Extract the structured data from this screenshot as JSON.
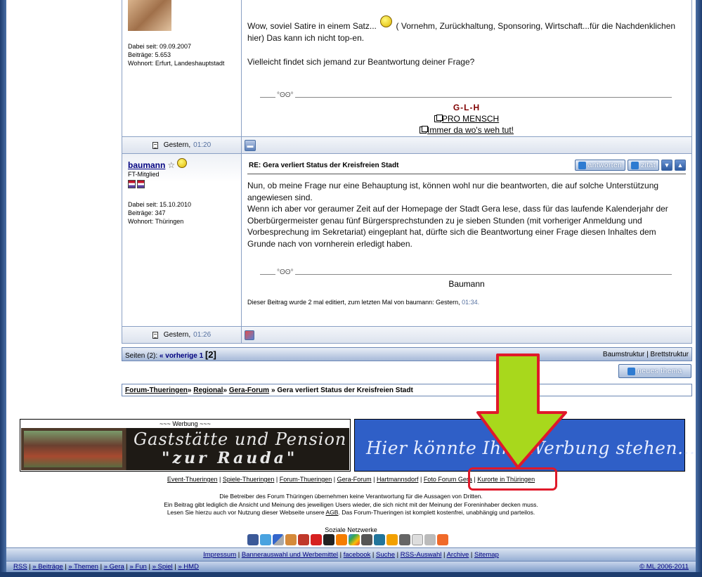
{
  "post1": {
    "meta": [
      "Dabei seit: 09.09.2007",
      "Beiträge: 5.653",
      "Wohnort: Erfurt, Landeshauptstadt"
    ],
    "text_line1": "Wow, soviel Satire in einem Satz...",
    "text_line1b": "( Vornehm, Zurückhaltung, Sponsoring, Wirtschaft...für die Nachdenklichen",
    "text_line2": "hier) Das kann ich nicht top-en.",
    "text_line3": "Vielleicht findet sich jemand zur Beantwortung deiner Frage?",
    "sig_title": "G-L-H",
    "sig_link1": "PRO MENSCH",
    "sig_link2": "Immer da wo's weh tut!",
    "footer_label": "Gestern,",
    "footer_time": "01:20"
  },
  "post2": {
    "username": "baumann",
    "rank": "FT-Mitglied",
    "meta": [
      "Dabei seit: 15.10.2010",
      "Beiträge: 347",
      "Wohnort: Thüringen"
    ],
    "subject": "RE: Gera verliert Status der Kreisfreien Stadt",
    "btn_reply": "antworten",
    "btn_quote": "zitat",
    "paragraphs": [
      "Nun, ob meine Frage nur eine Behauptung ist, können wohl nur die beantworten, die auf solche Unterstützung angewiesen sind.",
      "Wenn ich aber vor geraumer Zeit auf der Homepage der Stadt Gera lese, dass für das laufende Kalenderjahr der Oberbürgermeister genau fünf Bürgersprechstunden zu je sieben Stunden (mit vorheriger Anmeldung und Vorbesprechung im Sekretariat) eingeplant hat, dürfte sich die Beantwortung einer Frage diesen Inhaltes dem Grunde nach von vornherein erledigt haben."
    ],
    "signature": "Baumann",
    "edit_note": "Dieser Beitrag wurde 2 mal editiert, zum letzten Mal von baumann: Gestern,",
    "edit_time": "01:34.",
    "footer_label": "Gestern,",
    "footer_time": "01:26"
  },
  "pagebar": {
    "label": "Seiten (2):",
    "prev": "« vorherige",
    "page1": "1",
    "page2": "[2]",
    "tree": "Baumstruktur",
    "board": "Brettstruktur"
  },
  "new_thread": "neues thema",
  "breadcrumb": {
    "items": [
      "Forum-Thueringen",
      "Regional",
      "Gera-Forum"
    ],
    "current": "» Gera verliert Status der Kreisfreien Stadt"
  },
  "ads": {
    "caption": "~~~ Werbung ~~~",
    "left_line1": "Gaststätte und Pension",
    "left_line2": "\"zur Rauda\"",
    "right_text": "Hier könnte Ihre Werbung stehen..."
  },
  "partner_links": [
    "Event-Thueringen",
    "Spiele-Thueringen",
    "Forum-Thueringen",
    "Gera-Forum",
    "Hartmannsdorf",
    "Foto Forum Gera",
    "Kurorte in Thüringen"
  ],
  "disclaimer": [
    "Die Betreiber des Forum Thüringen übernehmen keine Verantwortung für die Aussagen von Dritten.",
    "Ein Beitrag gibt lediglich die Ansicht und Meinung des jeweiligen Users wieder, die sich nicht mit der Meinung der Foreninhaber decken muss.",
    "Lesen Sie hierzu auch vor Nutzung dieser Webseite unsere",
    "AGB",
    ". Das Forum-Thueringen ist komplett kostenfrei, unabhängig und parteilos."
  ],
  "social_label": "Soziale Netzwerke",
  "footer_links": [
    "Impressum",
    "Bannerauswahl und Werbemittel",
    "facebook",
    "Suche",
    "RSS-Auswahl",
    "Archive",
    "Sitemap"
  ],
  "bottom_nav": [
    "RSS",
    "» Beiträge",
    "» Themen",
    "» Gera",
    "» Fun",
    "» Spiel",
    "» HMD"
  ],
  "copyright": "© ML 2006-2011",
  "colors": {
    "annotation_arrow": "#a8d81c",
    "annotation_box": "#e0192a",
    "frame": "#1d3c6e"
  }
}
